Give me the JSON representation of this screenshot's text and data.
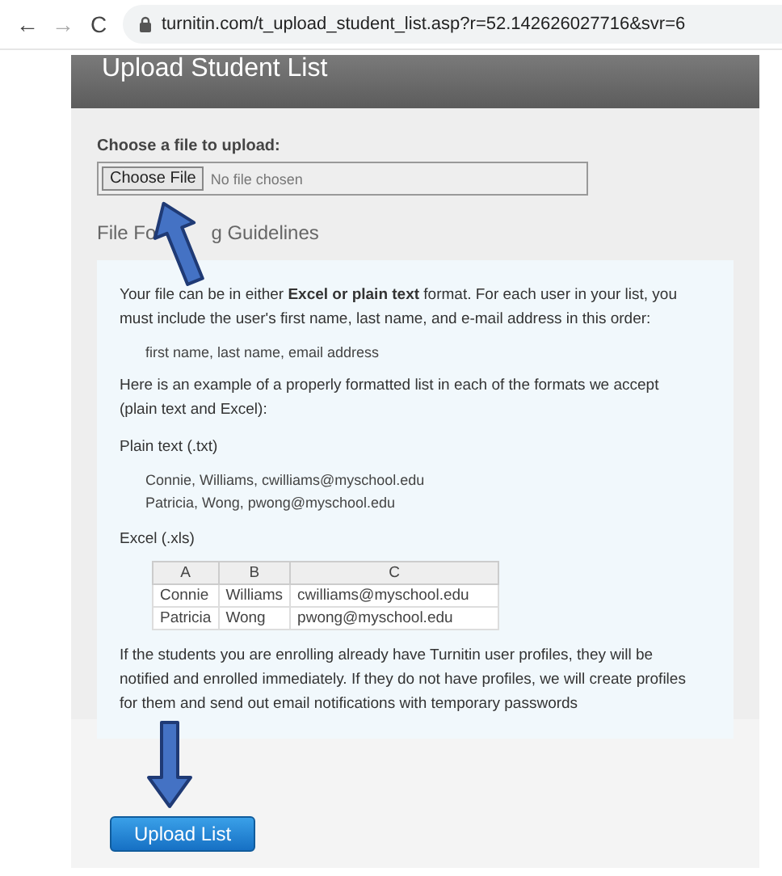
{
  "browser": {
    "back": "←",
    "forward": "→",
    "reload": "C",
    "url": "turnitin.com/t_upload_student_list.asp?r=52.142626027716&svr=6"
  },
  "panel": {
    "title": "Upload Student List",
    "file_label": "Choose a file to upload:",
    "choose_button": "Choose File",
    "file_status": "No file chosen",
    "guidelines_title": [
      "File Fo",
      "g Guidelines"
    ],
    "intro": "Your file can be in either **Excel or plain text** format. For each user in your list, you must include the user's first name, last name, and e-mail address in this order:",
    "order": "first name, last name, email address",
    "example_intro": "Here is an example of a properly formatted list in each of the formats we accept (plain text and Excel):",
    "plain_label": "Plain text (.txt)",
    "plain_lines": [
      "Connie, Williams, cwilliams@myschool.edu",
      "Patricia, Wong, pwong@myschool.edu"
    ],
    "excel_label": "Excel (.xls)",
    "table": {
      "columns": [
        "A",
        "B",
        "C"
      ],
      "rows": [
        [
          "Connie",
          "Williams",
          "cwilliams@myschool.edu"
        ],
        [
          "Patricia",
          "Wong",
          "pwong@myschool.edu"
        ]
      ]
    },
    "note": "If the students you are enrolling already have Turnitin user profiles, they will be notified and enrolled immediately. If they do not have profiles, we will create profiles for them and send out email notifications with temporary passwords",
    "submit_button": "Upload List"
  },
  "annotations": [
    {
      "kind": "up"
    },
    {
      "kind": "down"
    }
  ]
}
